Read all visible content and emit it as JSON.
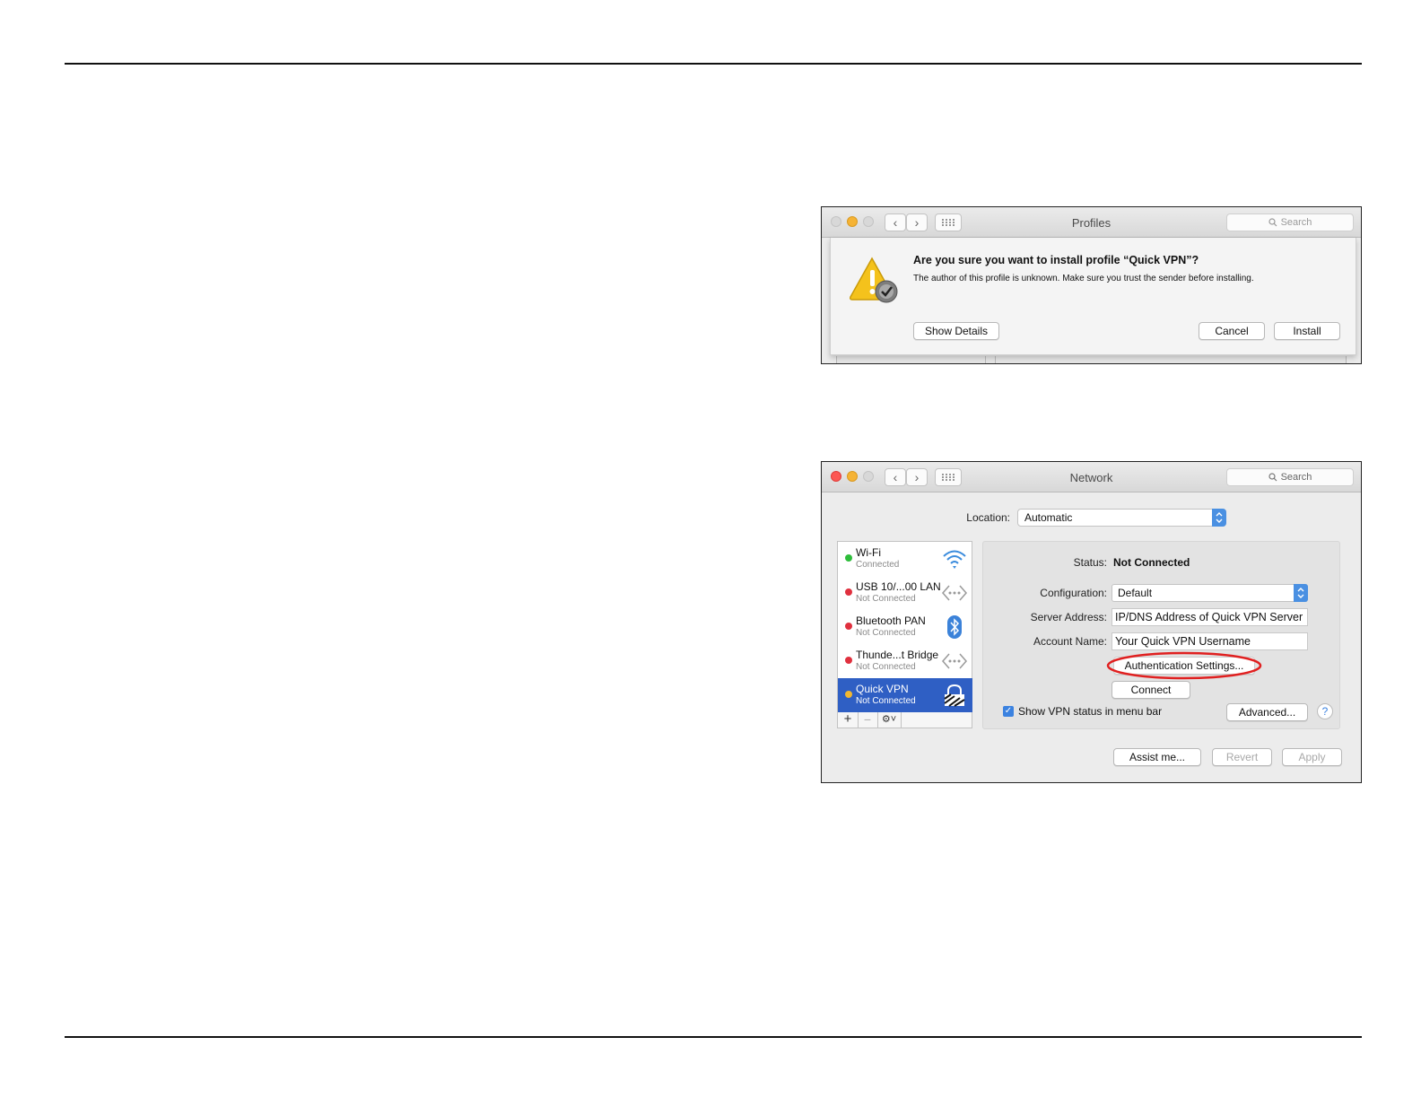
{
  "profiles_window": {
    "title": "Profiles",
    "search_placeholder": "Search",
    "dialog": {
      "heading": "Are you sure you want to install profile “Quick VPN”?",
      "message": "The author of this profile is unknown. Make sure you trust the sender before installing.",
      "show_details": "Show Details",
      "cancel": "Cancel",
      "install": "Install"
    }
  },
  "network_window": {
    "title": "Network",
    "search_placeholder": "Search",
    "location_label": "Location:",
    "location_value": "Automatic",
    "services": [
      {
        "name": "Wi-Fi",
        "status": "Connected",
        "dot": "#2ebd3b",
        "icon": "wifi-icon"
      },
      {
        "name": "USB 10/...00 LAN",
        "status": "Not Connected",
        "dot": "#e0303e",
        "icon": "ethernet-icon"
      },
      {
        "name": "Bluetooth PAN",
        "status": "Not Connected",
        "dot": "#e0303e",
        "icon": "bluetooth-icon"
      },
      {
        "name": "Thunde...t Bridge",
        "status": "Not Connected",
        "dot": "#e0303e",
        "icon": "ethernet-icon"
      },
      {
        "name": "Quick VPN",
        "status": "Not Connected",
        "dot": "#f1b731",
        "icon": "vpn-lock-icon"
      }
    ],
    "status_label": "Status:",
    "status_value": "Not Connected",
    "configuration_label": "Configuration:",
    "configuration_value": "Default",
    "server_address_label": "Server Address:",
    "server_address_value": "IP/DNS Address of Quick VPN Server",
    "account_name_label": "Account Name:",
    "account_name_value": "Your Quick VPN Username",
    "auth_settings": "Authentication Settings...",
    "connect": "Connect",
    "show_vpn_status": "Show VPN status in menu bar",
    "show_vpn_status_checked": true,
    "advanced": "Advanced...",
    "help": "?",
    "assist": "Assist me...",
    "revert": "Revert",
    "apply": "Apply",
    "selection_color": "#2f5fc4",
    "highlight_color": "#e02020"
  }
}
